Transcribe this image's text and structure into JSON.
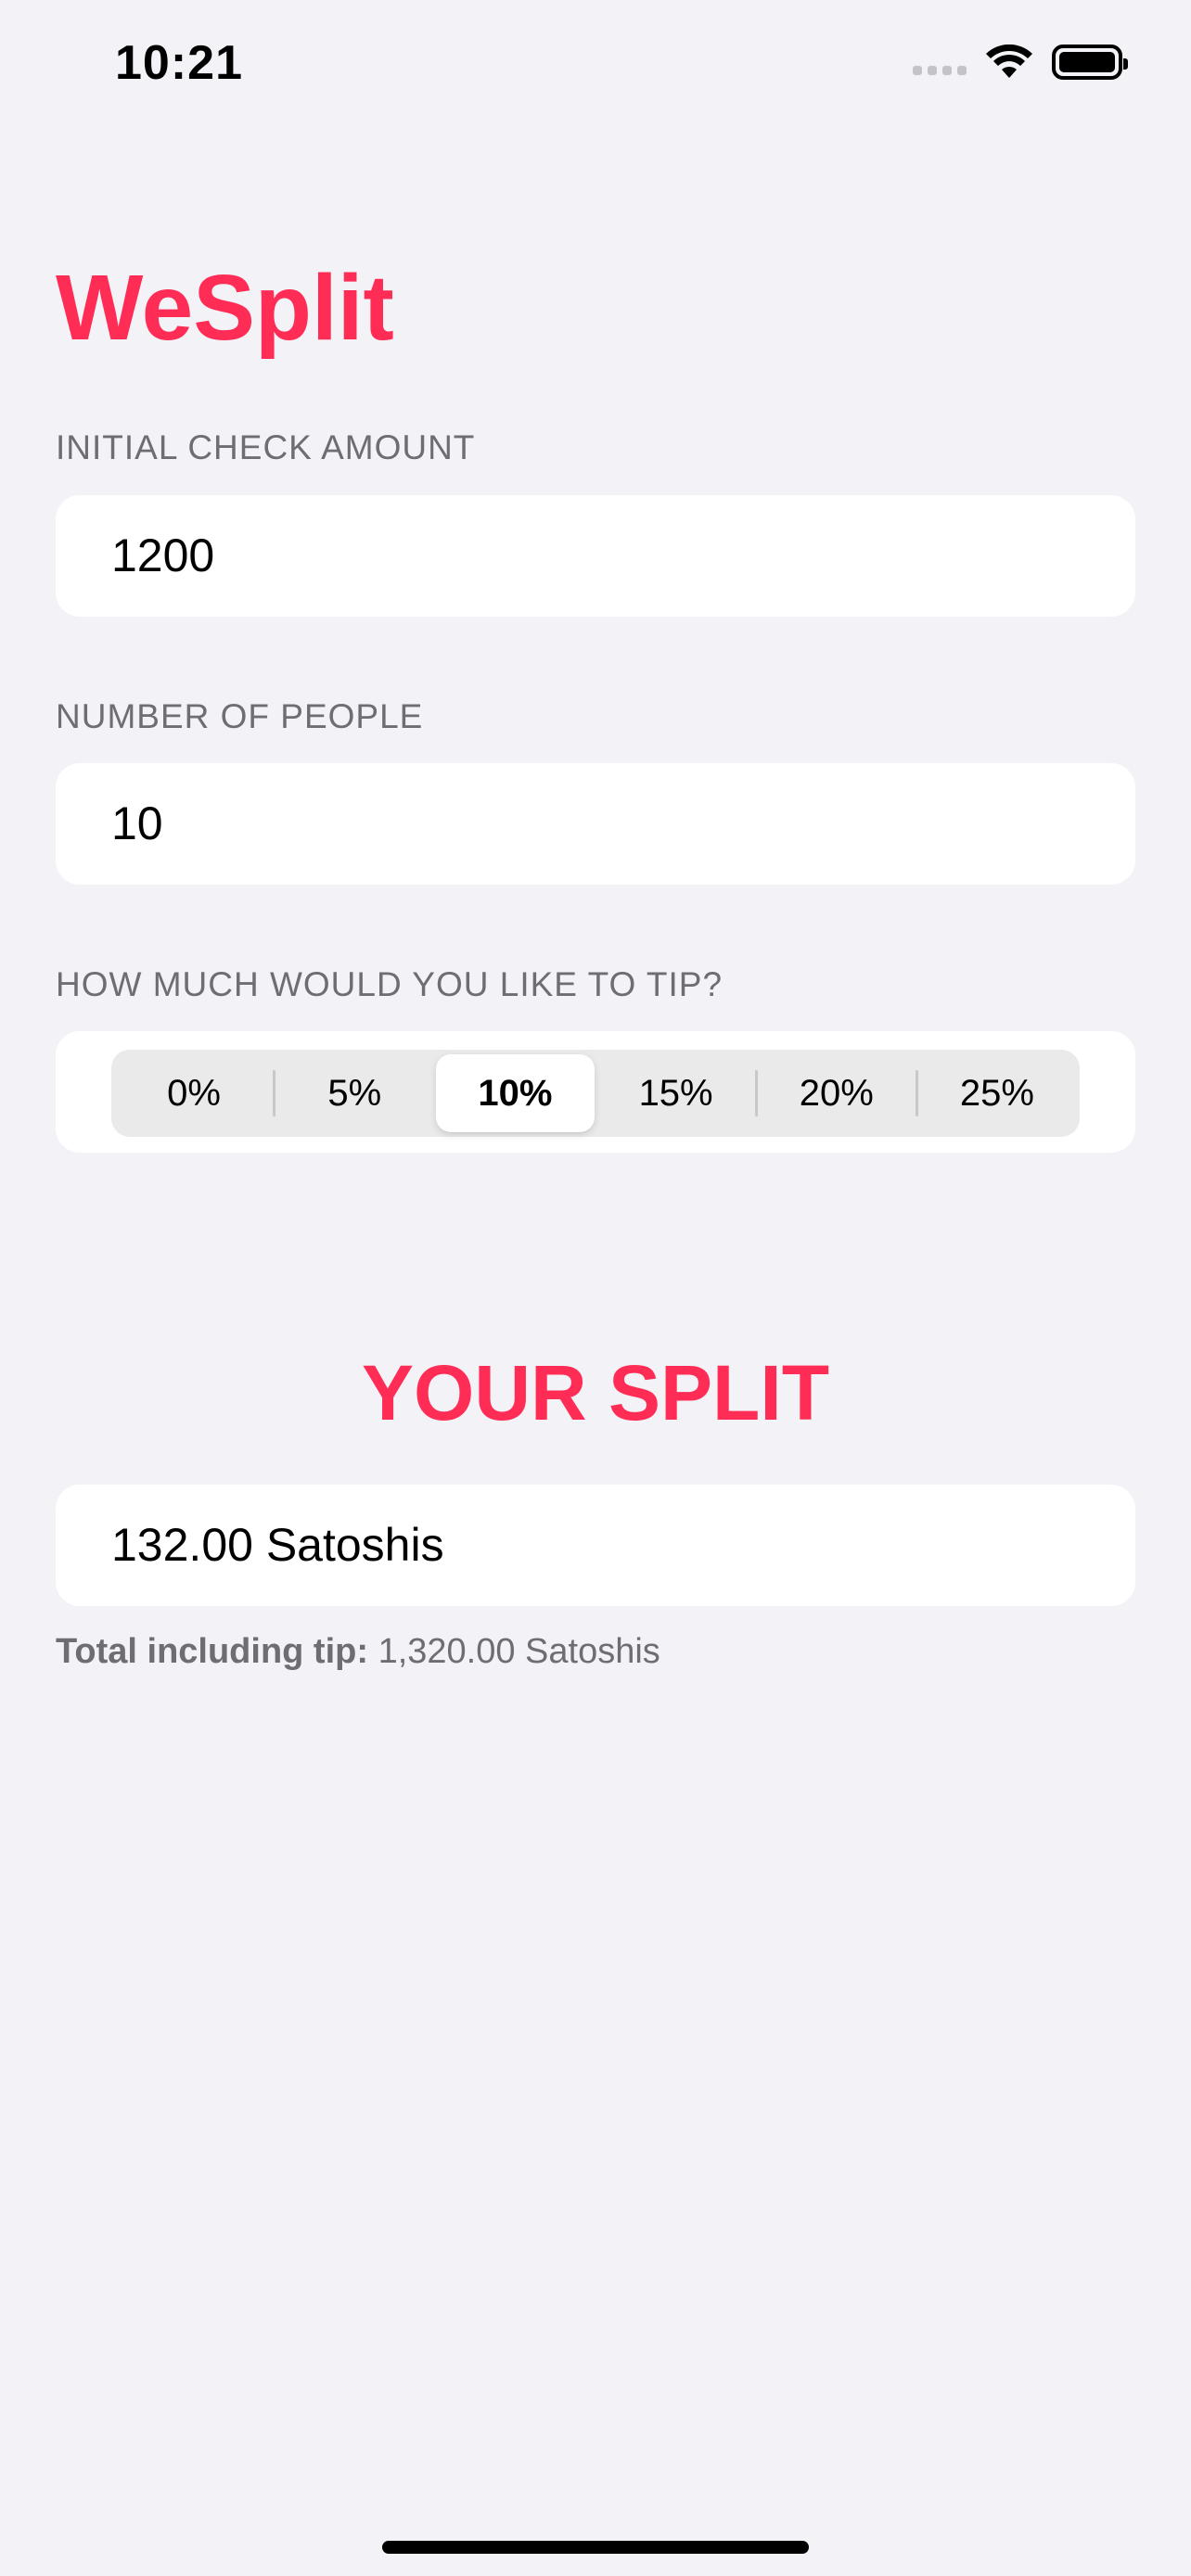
{
  "status_bar": {
    "time": "10:21",
    "icons": [
      "cellular-signal-icon",
      "wifi-icon",
      "battery-icon"
    ]
  },
  "app": {
    "title": "WeSplit",
    "accent_color": "#FF2D55",
    "background_color": "#F2F2F7"
  },
  "check_section": {
    "label": "INITIAL CHECK AMOUNT",
    "value": "1200"
  },
  "people_section": {
    "label": "NUMBER OF PEOPLE",
    "value": "10"
  },
  "tip_section": {
    "label": "HOW MUCH WOULD YOU LIKE TO TIP?",
    "options": [
      "0%",
      "5%",
      "10%",
      "15%",
      "20%",
      "25%"
    ],
    "selected": "10%"
  },
  "split_section": {
    "heading": "YOUR SPLIT",
    "per_person": "132.00 Satoshis",
    "total_label": "Total including tip:",
    "total_value": "1,320.00 Satoshis"
  }
}
